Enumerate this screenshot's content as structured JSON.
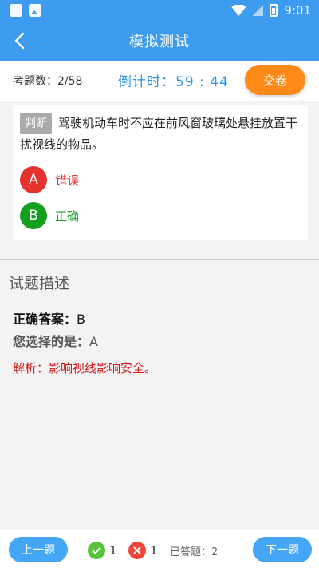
{
  "status": {
    "time": "9:01"
  },
  "nav": {
    "title": "模拟测试"
  },
  "info": {
    "count_label": "考题数：",
    "count_value": "2/58",
    "timer_label": "倒计时：",
    "timer_value": "59 : 44",
    "submit_label": "交卷"
  },
  "question": {
    "tag": "判断",
    "text": "驾驶机动车时不应在前风窗玻璃处悬挂放置干扰视线的物品。",
    "options": [
      {
        "letter": "A",
        "label": "错误",
        "color": "#e5322d"
      },
      {
        "letter": "B",
        "label": "正确",
        "color": "#14a01f"
      }
    ]
  },
  "description": {
    "title": "试题描述",
    "correct_label": "正确答案：",
    "correct_value": "B",
    "chosen_label": "您选择的是：",
    "chosen_value": "A",
    "explain_label": "解析：",
    "explain_text": "影响视线影响安全。"
  },
  "bottom": {
    "prev_label": "上一题",
    "next_label": "下一题",
    "correct_count": "1",
    "wrong_count": "1",
    "answered_label": "已答题：",
    "answered_value": "2"
  },
  "colors": {
    "header": "#3d9bf0",
    "accent": "#2b93e8",
    "submit": "#ff8a1a",
    "correct": "#14a01f",
    "wrong": "#e5322d"
  }
}
